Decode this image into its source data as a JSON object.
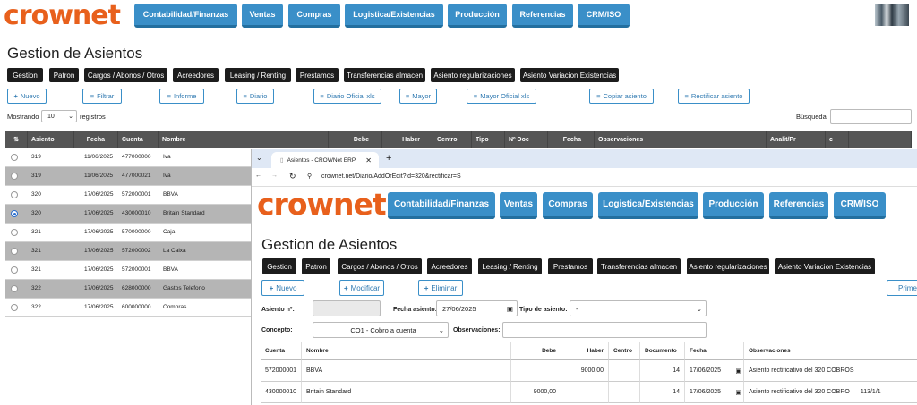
{
  "header": {
    "logo": "crownet",
    "nav": [
      "Contabilidad/Finanzas",
      "Ventas",
      "Compras",
      "Logistica/Existencias",
      "Producción",
      "Referencias",
      "CRM/ISO"
    ]
  },
  "page": {
    "title": "Gestion de Asientos"
  },
  "tabs": [
    "Gestion",
    "Patron",
    "Cargos / Abonos / Otros",
    "Acreedores",
    "Leasing / Renting",
    "Prestamos",
    "Transferencias almacen",
    "Asiento regularizaciones",
    "Asiento Variacion Existencias"
  ],
  "actions": {
    "nuevo": "Nuevo",
    "filtrar": "Filtrar",
    "informe": "Informe",
    "diario": "Diario",
    "diario_oficial": "Diario Oficial xls",
    "mayor": "Mayor",
    "mayor_oficial": "Mayor Oficial xls",
    "copiar": "Copiar asiento",
    "rectificar": "Rectificar asiento"
  },
  "length": {
    "prefix": "Mostrando",
    "value": "10",
    "suffix": "registros"
  },
  "search": {
    "label": "Búsqueda",
    "placeholder": ""
  },
  "table": {
    "headers": [
      "Asiento",
      "Fecha",
      "Cuenta",
      "Nombre",
      "Debe",
      "Haber",
      "Centro",
      "Tipo",
      "Nº Doc",
      "Fecha",
      "Observaciones",
      "Analit/Pr",
      "c"
    ],
    "rows": [
      {
        "asiento": "319",
        "fecha": "11/06/2025",
        "cuenta": "477000000",
        "nombre": "Iva"
      },
      {
        "asiento": "319",
        "fecha": "11/06/2025",
        "cuenta": "477000021",
        "nombre": "Iva"
      },
      {
        "asiento": "320",
        "fecha": "17/06/2025",
        "cuenta": "572000001",
        "nombre": "BBVA"
      },
      {
        "asiento": "320",
        "fecha": "17/06/2025",
        "cuenta": "430000010",
        "nombre": "Britain Standard"
      },
      {
        "asiento": "321",
        "fecha": "17/06/2025",
        "cuenta": "570000000",
        "nombre": "Caja"
      },
      {
        "asiento": "321",
        "fecha": "17/06/2025",
        "cuenta": "572000002",
        "nombre": "La Caixa"
      },
      {
        "asiento": "321",
        "fecha": "17/06/2025",
        "cuenta": "572000001",
        "nombre": "BBVA"
      },
      {
        "asiento": "322",
        "fecha": "17/06/2025",
        "cuenta": "628000000",
        "nombre": "Gastos Telefono"
      },
      {
        "asiento": "322",
        "fecha": "17/06/2025",
        "cuenta": "600000000",
        "nombre": "Compras"
      }
    ]
  },
  "overlay": {
    "tab_title": "Asientos - CROWNet ERP",
    "url": "crownet.net/Diario/AddOrEdit?id=320&rectificar=S",
    "page_title": "Gestion de Asientos",
    "buttons": {
      "nuevo": "Nuevo",
      "modificar": "Modificar",
      "eliminar": "Eliminar",
      "primero": "Primer"
    },
    "form": {
      "asiento_label": "Asiento nº:",
      "asiento_value": "",
      "fecha_label": "Fecha asiento:",
      "fecha_value": "27/06/2025",
      "tipo_label": "Tipo de asiento:",
      "tipo_value": "-",
      "concepto_label": "Concepto:",
      "concepto_value": "CO1 - Cobro a cuenta",
      "obs_label": "Observaciones:",
      "obs_value": ""
    },
    "grid": {
      "headers": [
        "Cuenta",
        "Nombre",
        "Debe",
        "Haber",
        "Centro",
        "Documento",
        "Fecha",
        "Observaciones"
      ],
      "rows": [
        {
          "cuenta": "572000001",
          "nombre": "BBVA",
          "debe": "",
          "haber": "9000,00",
          "centro": "",
          "doc": "14",
          "fecha": "17/06/2025",
          "obs": "Asiento rectificativo del 320 COBROS",
          "extra": ""
        },
        {
          "cuenta": "430000010",
          "nombre": "Britain Standard",
          "debe": "9000,00",
          "haber": "",
          "centro": "",
          "doc": "14",
          "fecha": "17/06/2025",
          "obs": "Asiento rectificativo del 320 COBRO",
          "extra": "113/1/1"
        }
      ]
    }
  }
}
